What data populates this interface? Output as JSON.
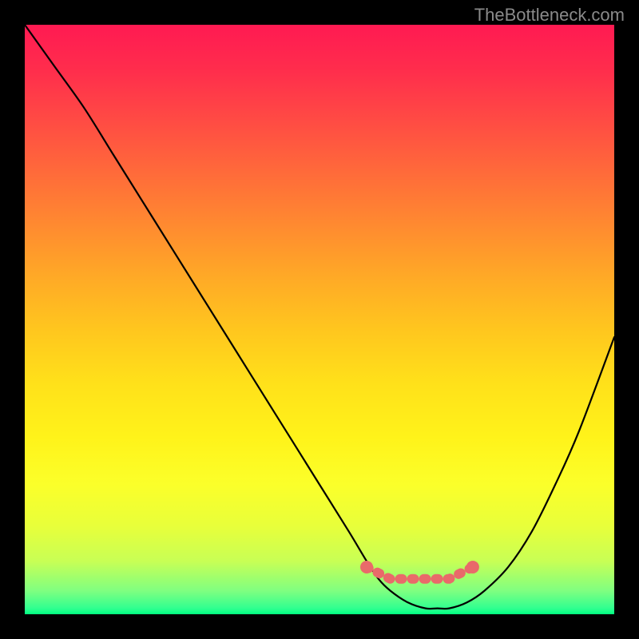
{
  "watermark": "TheBottleneck.com",
  "chart_data": {
    "type": "line",
    "title": "",
    "xlabel": "",
    "ylabel": "",
    "xlim": [
      0,
      100
    ],
    "ylim": [
      0,
      100
    ],
    "series": [
      {
        "name": "bottleneck-curve",
        "x": [
          0,
          5,
          10,
          15,
          20,
          25,
          30,
          35,
          40,
          45,
          50,
          55,
          58,
          60,
          62,
          65,
          68,
          70,
          72,
          75,
          78,
          82,
          86,
          90,
          94,
          100
        ],
        "values": [
          100,
          93,
          86,
          78,
          70,
          62,
          54,
          46,
          38,
          30,
          22,
          14,
          9,
          6,
          4,
          2,
          1,
          1,
          1,
          2,
          4,
          8,
          14,
          22,
          31,
          47
        ]
      }
    ],
    "markers": {
      "name": "highlight-band",
      "x": [
        58,
        60,
        62,
        64,
        66,
        68,
        70,
        72,
        74,
        76
      ],
      "values": [
        8,
        7,
        6,
        6,
        6,
        6,
        6,
        6,
        7,
        8
      ]
    }
  }
}
